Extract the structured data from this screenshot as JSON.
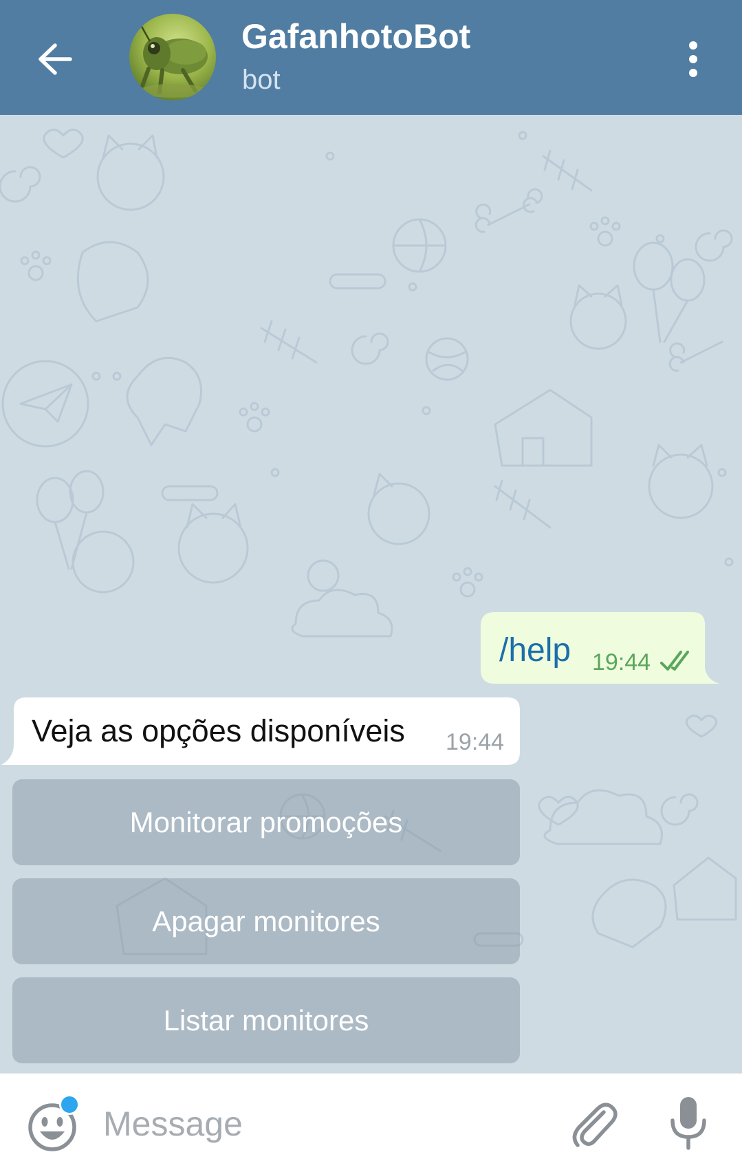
{
  "header": {
    "title": "GafanhotoBot",
    "subtitle": "bot",
    "background_color": "#517da2",
    "back_icon": "arrow-left-icon",
    "menu_icon": "more-vertical-icon",
    "avatar": "grasshopper-avatar"
  },
  "chat": {
    "wallpaper_color": "#cfdbe3",
    "messages": [
      {
        "direction": "outgoing",
        "text": "/help",
        "time": "19:44",
        "status_icon": "double-check-icon",
        "bubble_color": "#effdde"
      },
      {
        "direction": "incoming",
        "text": "Veja as opções disponíveis",
        "time": "19:44",
        "bubble_color": "#ffffff"
      }
    ],
    "keyboard_buttons": [
      {
        "label": "Monitorar promoções"
      },
      {
        "label": "Apagar monitores"
      },
      {
        "label": "Listar monitores"
      }
    ]
  },
  "input_bar": {
    "placeholder": "Message",
    "emoji_icon": "smiley-icon",
    "attach_icon": "paperclip-icon",
    "mic_icon": "microphone-icon",
    "notification_dot_color": "#2ea6ef"
  }
}
